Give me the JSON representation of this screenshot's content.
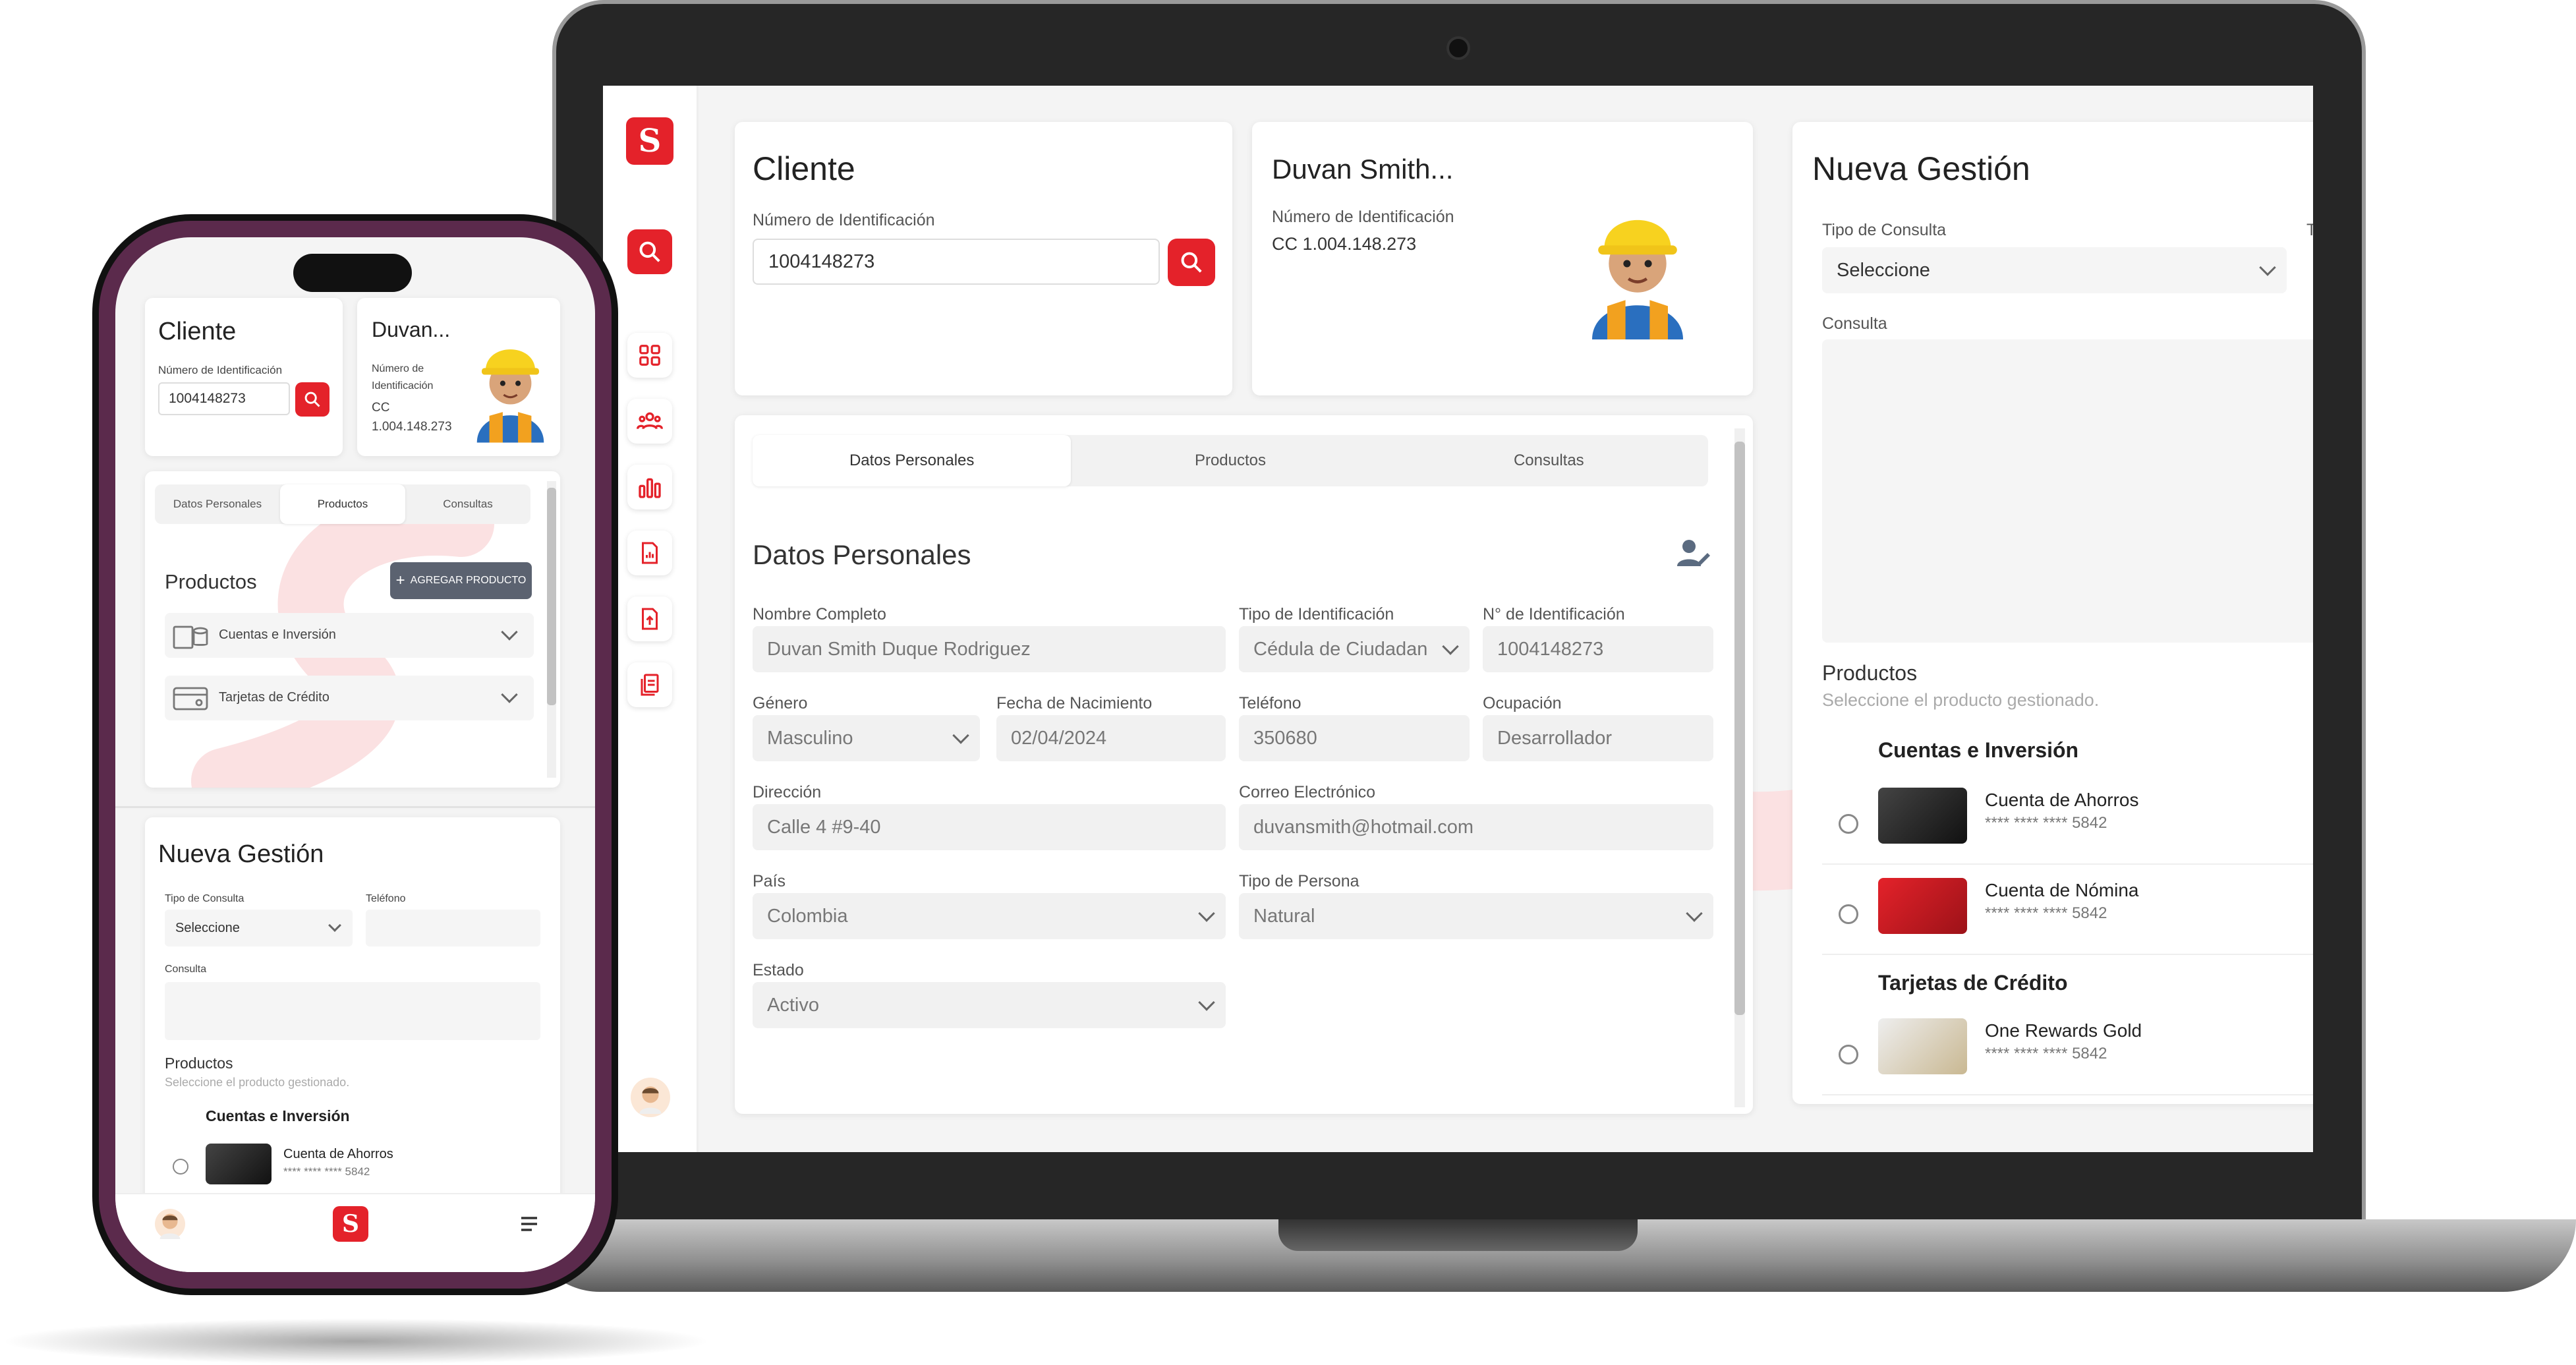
{
  "laptop": {
    "cliente": {
      "title": "Cliente",
      "id_label": "Número de Identificación",
      "id_value": "1004148273"
    },
    "profile": {
      "name": "Duvan Smith...",
      "id_label": "Número de Identificación",
      "id_value": "CC 1.004.148.273"
    },
    "tabs": [
      "Datos Personales",
      "Productos",
      "Consultas"
    ],
    "datos": {
      "title": "Datos Personales",
      "fields": {
        "nombre": {
          "label": "Nombre Completo",
          "value": "Duvan Smith Duque Rodriguez"
        },
        "tipo_id": {
          "label": "Tipo de Identificación",
          "value": "Cédula de Ciudadan"
        },
        "num_id": {
          "label": "N° de Identificación",
          "value": "1004148273"
        },
        "genero": {
          "label": "Género",
          "value": "Masculino"
        },
        "fecha": {
          "label": "Fecha de Nacimiento",
          "value": "02/04/2024"
        },
        "telefono": {
          "label": "Teléfono",
          "value": "350680"
        },
        "ocupacion": {
          "label": "Ocupación",
          "value": "Desarrollador"
        },
        "direccion": {
          "label": "Dirección",
          "value": "Calle 4 #9-40"
        },
        "correo": {
          "label": "Correo Electrónico",
          "value": "duvansmith@hotmail.com"
        },
        "pais": {
          "label": "País",
          "value": "Colombia"
        },
        "tipo_persona": {
          "label": "Tipo de Persona",
          "value": "Natural"
        },
        "estado": {
          "label": "Estado",
          "value": "Activo"
        }
      }
    },
    "gestion": {
      "title": "Nueva Gestión",
      "tipo_label": "Tipo de Consulta",
      "tipo_value": "Seleccione",
      "consulta_label": "Consulta",
      "productos_title": "Productos",
      "productos_sub": "Seleccione el producto gestionado.",
      "group1": "Cuentas e Inversión",
      "group2": "Tarjetas de Crédito",
      "items": [
        {
          "name": "Cuenta de Ahorros",
          "num": "**** **** **** 5842"
        },
        {
          "name": "Cuenta de Nómina",
          "num": "**** **** **** 5842"
        },
        {
          "name": "One Rewards Gold",
          "num": "**** **** **** 5842"
        }
      ],
      "peek": "T"
    },
    "brand": {
      "logo": "S",
      "red": "#e4222a"
    }
  },
  "phone": {
    "cliente": {
      "title": "Cliente",
      "id_label": "Número de Identificación",
      "id_value": "1004148273"
    },
    "profile": {
      "name": "Duvan...",
      "id_label": "Número de Identificación",
      "id_value": "CC 1.004.148.273"
    },
    "tabs": [
      "Datos Personales",
      "Productos",
      "Consultas"
    ],
    "productos_title": "Productos",
    "add_button": "AGREGAR PRODUCTO",
    "acc1": "Cuentas e Inversión",
    "acc2": "Tarjetas de Crédito",
    "gestion": {
      "title": "Nueva Gestión",
      "tipo_label": "Tipo de Consulta",
      "tel_label": "Teléfono",
      "tipo_value": "Seleccione",
      "consulta_label": "Consulta",
      "productos_title": "Productos",
      "productos_sub": "Seleccione el producto gestionado.",
      "group1": "Cuentas e Inversión",
      "item_name": "Cuenta de Ahorros",
      "item_num": "**** **** **** 5842"
    }
  }
}
